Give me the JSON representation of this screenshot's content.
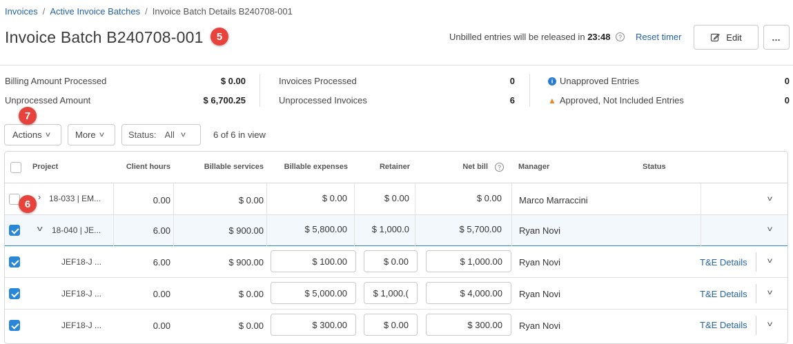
{
  "breadcrumb": {
    "items": [
      "Invoices",
      "Active Invoice Batches"
    ],
    "separator": "/",
    "current": "Invoice Batch Details B240708-001"
  },
  "header": {
    "title": "Invoice Batch B240708-001",
    "timer_prefix": "Unbilled entries will be released in",
    "timer_value": "23:48",
    "reset_label": "Reset timer",
    "edit_label": "Edit",
    "more_label": "…"
  },
  "badges": {
    "title": "5",
    "actions": "7",
    "row": "6"
  },
  "summary": {
    "billing_processed_label": "Billing Amount Processed",
    "billing_processed_value": "$ 0.00",
    "unprocessed_amount_label": "Unprocessed Amount",
    "unprocessed_amount_value": "$ 6,700.25",
    "invoices_processed_label": "Invoices Processed",
    "invoices_processed_value": "0",
    "unprocessed_invoices_label": "Unprocessed Invoices",
    "unprocessed_invoices_value": "6",
    "unapproved_label": "Unapproved Entries",
    "unapproved_value": "0",
    "approved_not_included_label": "Approved, Not Included Entries",
    "approved_not_included_value": "0"
  },
  "toolbar": {
    "actions_label": "Actions",
    "more_label": "More",
    "status_label": "Status:",
    "status_value": "All",
    "in_view": "6 of 6 in view"
  },
  "table": {
    "columns": {
      "project": "Project",
      "client_hours": "Client hours",
      "billable_services": "Billable services",
      "billable_expenses": "Billable expenses",
      "retainer": "Retainer",
      "net_bill": "Net bill",
      "net_bill_help": "?",
      "manager": "Manager",
      "status": "Status"
    },
    "rows": [
      {
        "project": "18-033 | EM...",
        "client_hours": "0.00",
        "billable_services": "$ 0.00",
        "billable_expenses": "$ 0.00",
        "retainer": "$ 0.00",
        "net_bill": "$ 0.00",
        "manager": "Marco Marraccini",
        "te": ""
      },
      {
        "project": "18-040 | JE...",
        "client_hours": "6.00",
        "billable_services": "$ 900.00",
        "billable_expenses": "$ 5,800.00",
        "retainer": "$ 1,000.0",
        "net_bill": "$ 5,700.00",
        "manager": "Ryan Novi",
        "te": ""
      },
      {
        "project": "JEF18-J ...",
        "client_hours": "6.00",
        "billable_services": "$ 900.00",
        "billable_expenses": "$ 100.00",
        "retainer": "$ 0.00",
        "net_bill": "$ 1,000.00",
        "manager": "Ryan Novi",
        "te": "T&E Details"
      },
      {
        "project": "JEF18-J ...",
        "client_hours": "0.00",
        "billable_services": "$ 0.00",
        "billable_expenses": "$ 5,000.00",
        "retainer": "$ 1,000.(",
        "net_bill": "$ 4,000.00",
        "manager": "Ryan Novi",
        "te": "T&E Details"
      },
      {
        "project": "JEF18-J ...",
        "client_hours": "0.00",
        "billable_services": "$ 0.00",
        "billable_expenses": "$ 300.00",
        "retainer": "$ 0.00",
        "net_bill": "$ 300.00",
        "manager": "Ryan Novi",
        "te": "T&E Details"
      }
    ]
  },
  "colors": {
    "accent": "#2463a8",
    "checkbox": "#2a87d8",
    "badge": "#e8423d",
    "warning": "#e0882a"
  },
  "icons": [
    "edit-icon",
    "help-icon",
    "info-icon",
    "warning-icon",
    "chevron-down-icon",
    "chevron-right-icon"
  ]
}
